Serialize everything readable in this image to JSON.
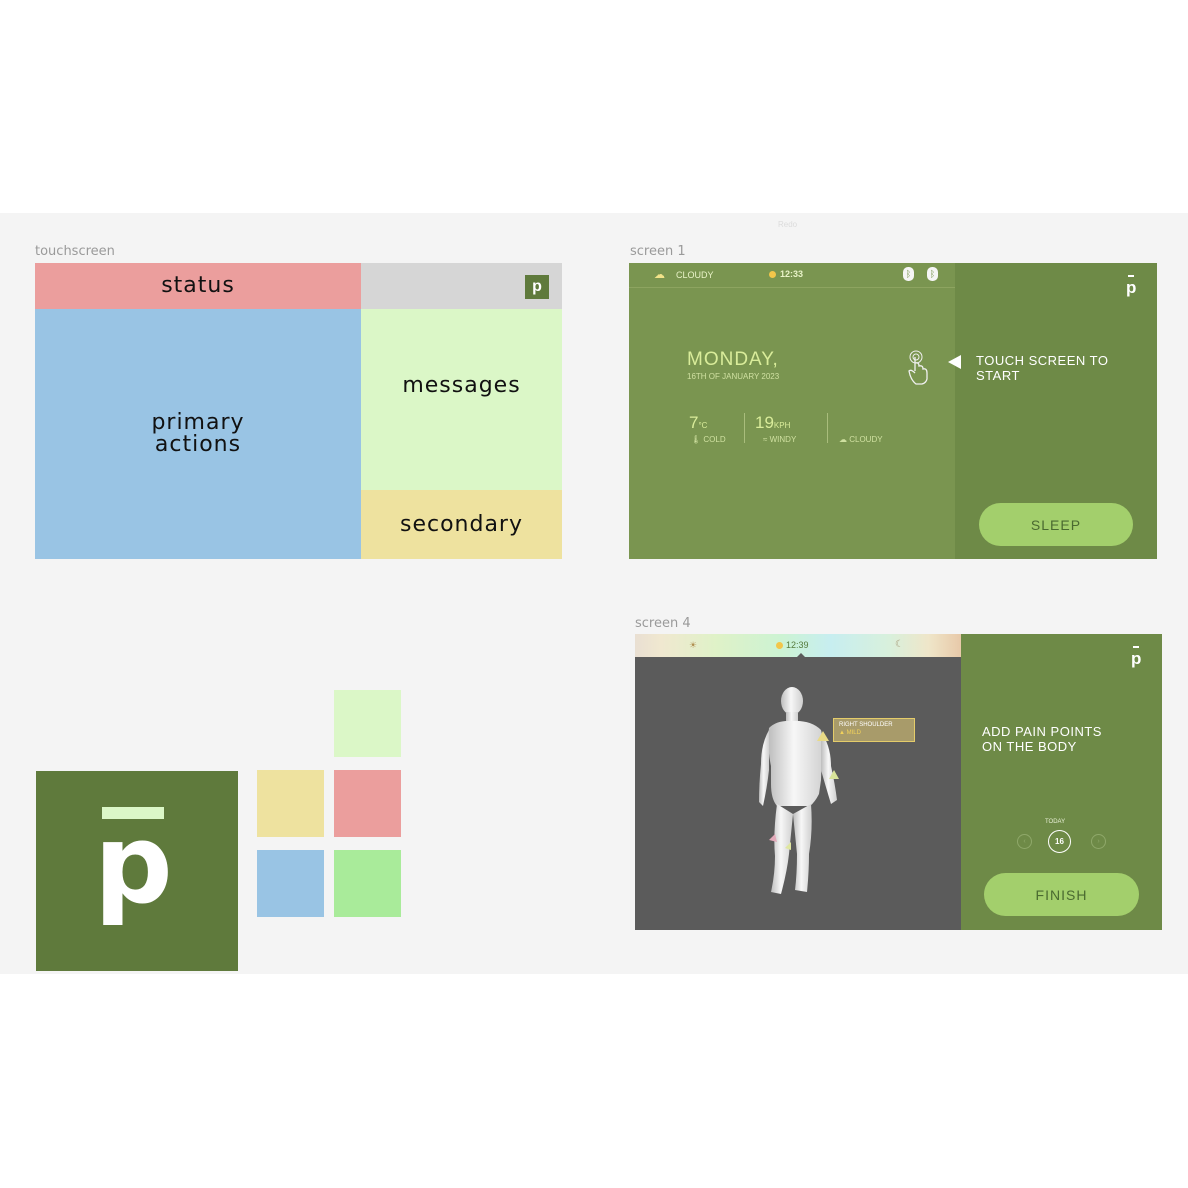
{
  "canvas_title": "Redo",
  "touchscreen": {
    "label": "touchscreen",
    "regions": {
      "status": "status",
      "primary_actions": "primary actions",
      "messages": "messages",
      "secondary": "secondary"
    },
    "logo_letter": "p"
  },
  "screen1": {
    "label": "screen 1",
    "status_bar": {
      "weather": "CLOUDY",
      "time": "12:33"
    },
    "day": "MONDAY,",
    "date": "16TH OF JANUARY 2023",
    "stats": [
      {
        "value": "7",
        "unit": "°C",
        "caption": "COLD"
      },
      {
        "value": "19",
        "unit": "KPH",
        "caption": "WINDY"
      },
      {
        "value": "",
        "unit": "",
        "caption": "CLOUDY"
      }
    ],
    "prompt": "TOUCH SCREEN TO START",
    "button": "SLEEP",
    "logo_letter": "p"
  },
  "screen4": {
    "label": "screen 4",
    "time": "12:39",
    "tooltip_title": "RIGHT SHOULDER",
    "tooltip_level": "MILD",
    "prompt": "ADD PAIN POINTS ON THE BODY",
    "today_label": "TODAY",
    "day_number": "16",
    "button": "FINISH",
    "logo_letter": "p"
  },
  "palette": {
    "brand_green": "#5f7a3c",
    "status_red": "#eb9e9d",
    "primary_blue": "#99c4e4",
    "messages_green": "#dbf7c7",
    "secondary_yellow": "#eee29f",
    "bright_green": "#a9eb9a",
    "screen_green": "#7a9550",
    "panel_green": "#6e8a47",
    "pill_green": "#a3cf6c"
  },
  "brand_logo_letter": "p"
}
